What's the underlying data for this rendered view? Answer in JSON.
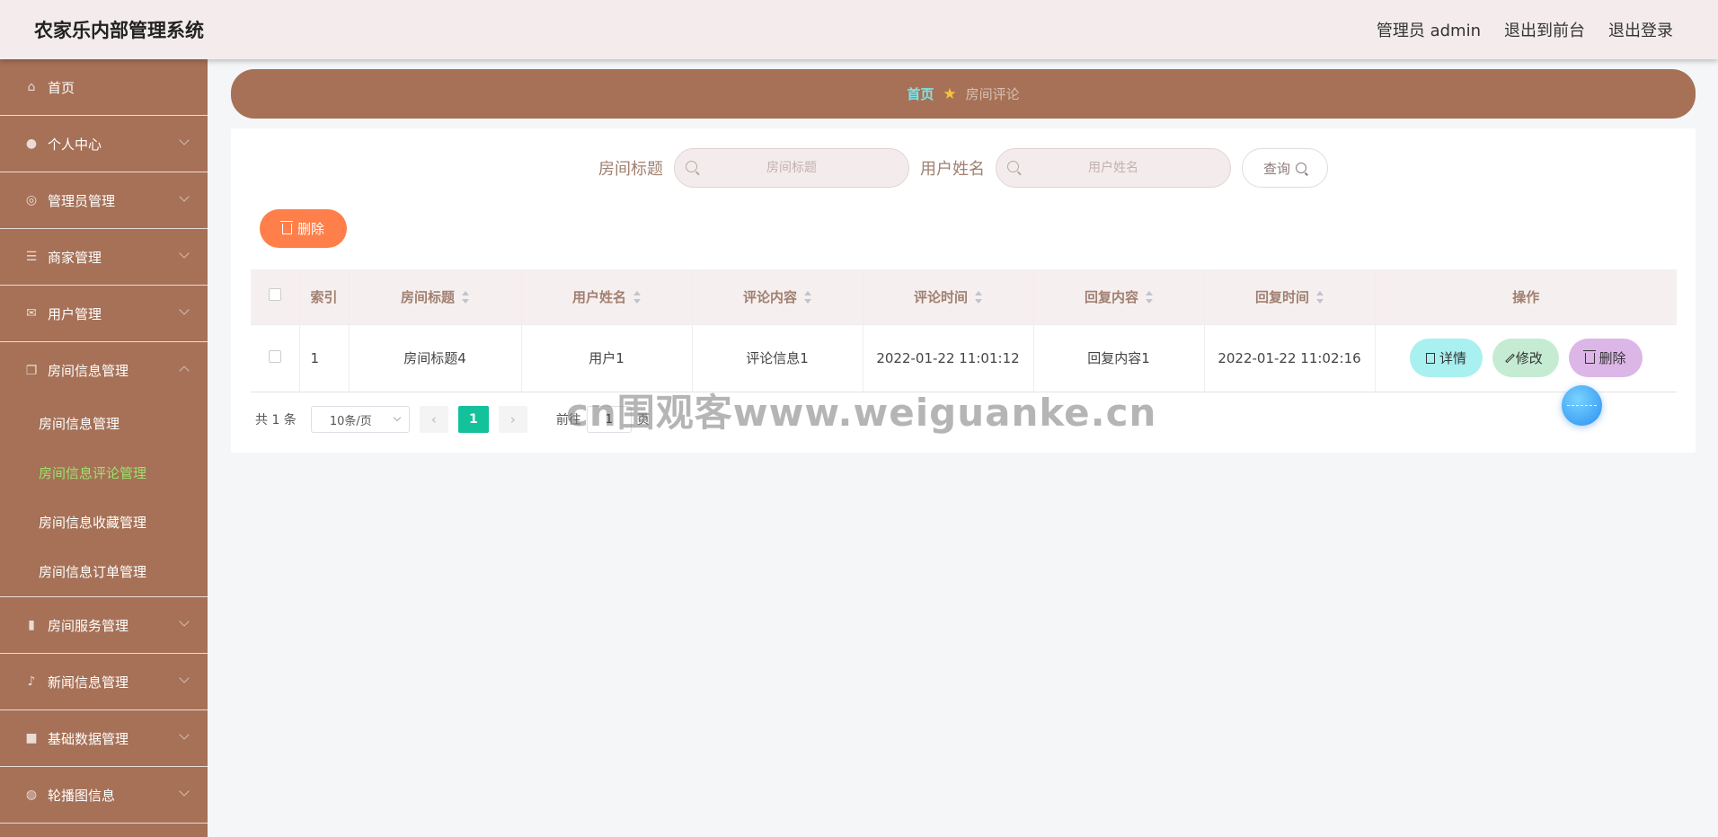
{
  "header": {
    "app_title": "农家乐内部管理系统",
    "admin_label": "管理员 admin",
    "to_front": "退出到前台",
    "logout": "退出登录"
  },
  "sidebar": {
    "items": [
      {
        "label": "首页",
        "icon": "home-icon"
      },
      {
        "label": "个人中心",
        "icon": "user-icon"
      },
      {
        "label": "管理员管理",
        "icon": "settings-icon"
      },
      {
        "label": "商家管理",
        "icon": "sliders-icon"
      },
      {
        "label": "用户管理",
        "icon": "mail-icon"
      },
      {
        "label": "房间信息管理",
        "icon": "copy-icon"
      }
    ],
    "submenu": [
      "房间信息管理",
      "房间信息评论管理",
      "房间信息收藏管理",
      "房间信息订单管理"
    ],
    "items_after": [
      {
        "label": "房间服务管理",
        "icon": "chart-icon"
      },
      {
        "label": "新闻信息管理",
        "icon": "microphone-icon"
      },
      {
        "label": "基础数据管理",
        "icon": "briefcase-icon"
      },
      {
        "label": "轮播图信息",
        "icon": "compass-icon"
      }
    ],
    "active_submenu": "房间信息评论管理"
  },
  "breadcrumb": {
    "home": "首页",
    "current": "房间评论"
  },
  "search": {
    "title_label": "房间标题",
    "title_placeholder": "房间标题",
    "user_label": "用户姓名",
    "user_placeholder": "用户姓名",
    "query_button": "查询"
  },
  "toolbar": {
    "delete_label": "删除"
  },
  "table": {
    "columns": [
      "索引",
      "房间标题",
      "用户姓名",
      "评论内容",
      "评论时间",
      "回复内容",
      "回复时间",
      "操作"
    ],
    "rows": [
      {
        "index": "1",
        "title": "房间标题4",
        "user": "用户1",
        "comment": "评论信息1",
        "comment_time": "2022-01-22 11:01:12",
        "reply": "回复内容1",
        "reply_time": "2022-01-22 11:02:16"
      }
    ],
    "actions": {
      "detail": "详情",
      "edit": "修改",
      "delete": "删除"
    }
  },
  "pagination": {
    "total": "共 1 条",
    "page_size": "10条/页",
    "current_page": "1",
    "goto_prefix": "前往",
    "goto_value": "1",
    "goto_suffix": "页"
  },
  "watermark": "cn围观客www.weiguanke.cn",
  "colors": {
    "sidebar_bg": "#a67157",
    "header_bg": "#f4ecec",
    "active_submenu": "#9be36b",
    "delete_button": "#ff7f4a",
    "page_active": "#13c19b"
  }
}
